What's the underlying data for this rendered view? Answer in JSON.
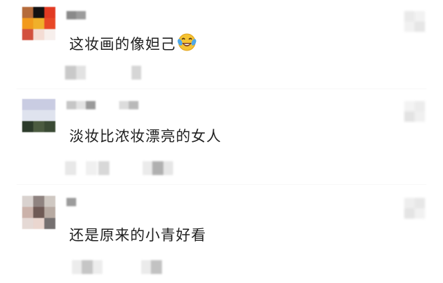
{
  "comments": [
    {
      "text": "这妆画的像妲己",
      "emoji": "laughing-crying-emoji"
    },
    {
      "text": "淡妆比浓妆漂亮的女人"
    },
    {
      "text": "还是原来的小青好看"
    }
  ],
  "colors": {
    "text": "#1f1f1f",
    "mosaic_light": "#e4e4e4",
    "mosaic_mid": "#bdbdbd",
    "emoji_face": "#f5c332"
  }
}
